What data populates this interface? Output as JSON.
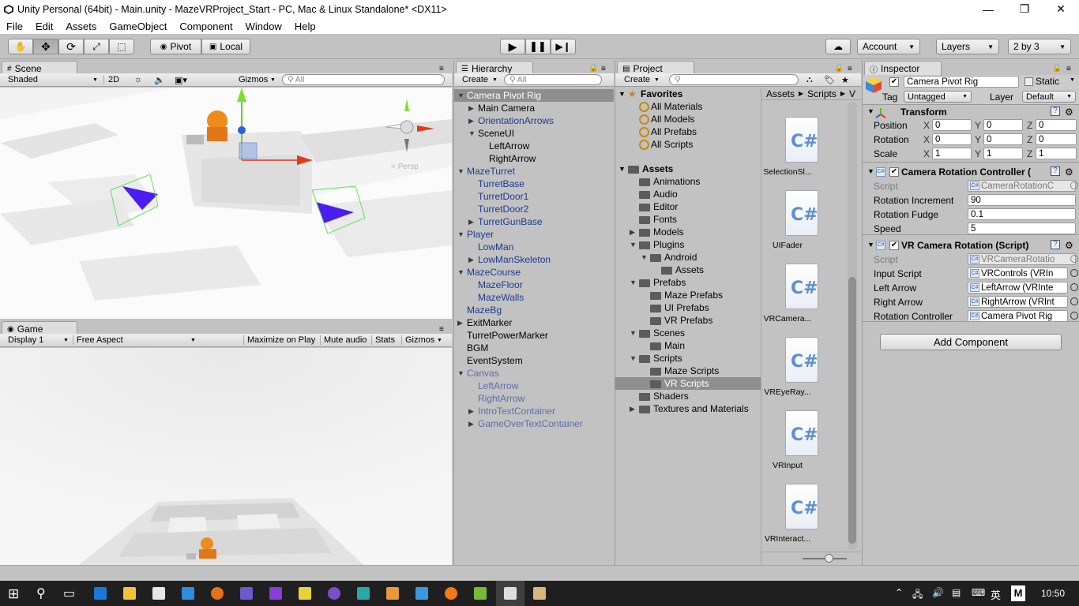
{
  "window": {
    "title": "Unity Personal (64bit) - Main.unity - MazeVRProject_Start - PC, Mac & Linux Standalone* <DX11>",
    "minimize": "—",
    "restore": "❐",
    "close": "✕"
  },
  "menu": [
    "File",
    "Edit",
    "Assets",
    "GameObject",
    "Component",
    "Window",
    "Help"
  ],
  "toolbar": {
    "pivot": "Pivot",
    "local": "Local",
    "account": "Account",
    "layers": "Layers",
    "layout": "2 by 3"
  },
  "scene": {
    "tab": "Scene",
    "shading": "Shaded",
    "mode2d": "2D",
    "gizmos": "Gizmos",
    "search_placeholder": "All",
    "persp": "< Persp"
  },
  "game": {
    "tab": "Game",
    "display": "Display 1",
    "aspect": "Free Aspect",
    "maximize": "Maximize on Play",
    "mute": "Mute audio",
    "stats": "Stats",
    "gizmos": "Gizmos"
  },
  "hierarchy": {
    "tab": "Hierarchy",
    "create": "Create",
    "search_placeholder": "All",
    "items": [
      {
        "label": "Camera Pivot Rig",
        "depth": 0,
        "arrow": "down",
        "style": "selected"
      },
      {
        "label": "Main Camera",
        "depth": 1,
        "arrow": "right",
        "style": "normal"
      },
      {
        "label": "OrientationArrows",
        "depth": 1,
        "arrow": "right",
        "style": "blue"
      },
      {
        "label": "SceneUI",
        "depth": 1,
        "arrow": "down",
        "style": "normal"
      },
      {
        "label": "LeftArrow",
        "depth": 2,
        "arrow": "",
        "style": "normal"
      },
      {
        "label": "RightArrow",
        "depth": 2,
        "arrow": "",
        "style": "normal"
      },
      {
        "label": "MazeTurret",
        "depth": 0,
        "arrow": "down",
        "style": "blue"
      },
      {
        "label": "TurretBase",
        "depth": 1,
        "arrow": "",
        "style": "blue"
      },
      {
        "label": "TurretDoor1",
        "depth": 1,
        "arrow": "",
        "style": "blue"
      },
      {
        "label": "TurretDoor2",
        "depth": 1,
        "arrow": "",
        "style": "blue"
      },
      {
        "label": "TurretGunBase",
        "depth": 1,
        "arrow": "right",
        "style": "blue"
      },
      {
        "label": "Player",
        "depth": 0,
        "arrow": "down",
        "style": "blue"
      },
      {
        "label": "LowMan",
        "depth": 1,
        "arrow": "",
        "style": "blue"
      },
      {
        "label": "LowManSkeleton",
        "depth": 1,
        "arrow": "right",
        "style": "blue"
      },
      {
        "label": "MazeCourse",
        "depth": 0,
        "arrow": "down",
        "style": "blue"
      },
      {
        "label": "MazeFloor",
        "depth": 1,
        "arrow": "",
        "style": "blue"
      },
      {
        "label": "MazeWalls",
        "depth": 1,
        "arrow": "",
        "style": "blue"
      },
      {
        "label": "MazeBg",
        "depth": 0,
        "arrow": "",
        "style": "blue"
      },
      {
        "label": "ExitMarker",
        "depth": 0,
        "arrow": "right",
        "style": "normal"
      },
      {
        "label": "TurretPowerMarker",
        "depth": 0,
        "arrow": "",
        "style": "normal"
      },
      {
        "label": "BGM",
        "depth": 0,
        "arrow": "",
        "style": "normal"
      },
      {
        "label": "EventSystem",
        "depth": 0,
        "arrow": "",
        "style": "normal"
      },
      {
        "label": "Canvas",
        "depth": 0,
        "arrow": "down",
        "style": "faded"
      },
      {
        "label": "LeftArrow",
        "depth": 1,
        "arrow": "",
        "style": "faded"
      },
      {
        "label": "RightArrow",
        "depth": 1,
        "arrow": "",
        "style": "faded"
      },
      {
        "label": "IntroTextContainer",
        "depth": 1,
        "arrow": "right",
        "style": "faded"
      },
      {
        "label": "GameOverTextContainer",
        "depth": 1,
        "arrow": "right",
        "style": "faded"
      }
    ]
  },
  "project": {
    "tab": "Project",
    "create": "Create",
    "favorites_label": "Favorites",
    "favorites": [
      "All Materials",
      "All Models",
      "All Prefabs",
      "All Scripts"
    ],
    "assets_label": "Assets",
    "tree": [
      {
        "label": "Animations",
        "depth": 1,
        "arrow": ""
      },
      {
        "label": "Audio",
        "depth": 1,
        "arrow": ""
      },
      {
        "label": "Editor",
        "depth": 1,
        "arrow": ""
      },
      {
        "label": "Fonts",
        "depth": 1,
        "arrow": ""
      },
      {
        "label": "Models",
        "depth": 1,
        "arrow": "right"
      },
      {
        "label": "Plugins",
        "depth": 1,
        "arrow": "down"
      },
      {
        "label": "Android",
        "depth": 2,
        "arrow": "down"
      },
      {
        "label": "Assets",
        "depth": 3,
        "arrow": ""
      },
      {
        "label": "Prefabs",
        "depth": 1,
        "arrow": "down"
      },
      {
        "label": "Maze Prefabs",
        "depth": 2,
        "arrow": ""
      },
      {
        "label": "UI Prefabs",
        "depth": 2,
        "arrow": ""
      },
      {
        "label": "VR Prefabs",
        "depth": 2,
        "arrow": ""
      },
      {
        "label": "Scenes",
        "depth": 1,
        "arrow": "down"
      },
      {
        "label": "Main",
        "depth": 2,
        "arrow": ""
      },
      {
        "label": "Scripts",
        "depth": 1,
        "arrow": "down"
      },
      {
        "label": "Maze Scripts",
        "depth": 2,
        "arrow": ""
      },
      {
        "label": "VR Scripts",
        "depth": 2,
        "arrow": "",
        "selected": true
      },
      {
        "label": "Shaders",
        "depth": 1,
        "arrow": ""
      },
      {
        "label": "Textures and Materials",
        "depth": 1,
        "arrow": "right"
      }
    ],
    "breadcrumb": [
      "Assets",
      "Scripts",
      "V"
    ],
    "files": [
      "SelectionSl...",
      "UIFader",
      "VRCamera...",
      "VREyeRay...",
      "VRInput",
      "VRInteract..."
    ]
  },
  "inspector": {
    "tab": "Inspector",
    "object_name": "Camera Pivot Rig",
    "static_label": "Static",
    "tag_label": "Tag",
    "tag_value": "Untagged",
    "layer_label": "Layer",
    "layer_value": "Default",
    "transform": {
      "title": "Transform",
      "rows": [
        {
          "label": "Position",
          "x": "0",
          "y": "0",
          "z": "0"
        },
        {
          "label": "Rotation",
          "x": "0",
          "y": "0",
          "z": "0"
        },
        {
          "label": "Scale",
          "x": "1",
          "y": "1",
          "z": "1"
        }
      ]
    },
    "camera_rotation_controller": {
      "title": "Camera Rotation Controller (",
      "script_label": "Script",
      "script_value": "CameraRotationC",
      "fields": [
        {
          "label": "Rotation Increment",
          "value": "90"
        },
        {
          "label": "Rotation Fudge",
          "value": "0.1"
        },
        {
          "label": "Speed",
          "value": "5"
        }
      ]
    },
    "vr_camera_rotation": {
      "title": "VR Camera Rotation (Script)",
      "script_label": "Script",
      "script_value": "VRCameraRotatio",
      "fields": [
        {
          "label": "Input Script",
          "value": "VRControls (VRIn"
        },
        {
          "label": "Left Arrow",
          "value": "LeftArrow (VRInte"
        },
        {
          "label": "Right Arrow",
          "value": "RightArrow (VRInt"
        },
        {
          "label": "Rotation Controller",
          "value": "Camera Pivot Rig"
        }
      ]
    },
    "add_component": "Add Component"
  },
  "taskbar": {
    "clock": "10:50",
    "ime": "英",
    "ime2": "M"
  }
}
